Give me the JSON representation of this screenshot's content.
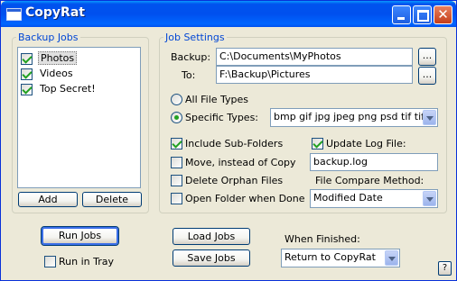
{
  "window": {
    "title": "CopyRat",
    "icons": {
      "app": "app-window-icon",
      "minimize": "minimize-icon",
      "maximize": "maximize-icon",
      "close": "close-icon"
    },
    "close_glyph": "✕"
  },
  "backup_jobs": {
    "legend": "Backup Jobs",
    "items": [
      {
        "label": "Photos",
        "checked": true,
        "selected": true
      },
      {
        "label": "Videos",
        "checked": true,
        "selected": false
      },
      {
        "label": "Top Secret!",
        "checked": true,
        "selected": false
      }
    ],
    "add_label": "Add",
    "delete_label": "Delete"
  },
  "job_settings": {
    "legend": "Job Settings",
    "backup_label": "Backup:",
    "backup_value": "C:\\Documents\\MyPhotos",
    "to_label": "To:",
    "to_value": "F:\\Backup\\Pictures",
    "browse_label": "...",
    "all_file_types_label": "All File Types",
    "specific_types_label": "Specific Types:",
    "specific_types_value": "bmp gif jpg jpeg png psd tif tiff tga",
    "file_type_mode": "specific",
    "include_subfolders_label": "Include Sub-Folders",
    "include_subfolders": true,
    "move_instead_label": "Move, instead of Copy",
    "move_instead": false,
    "delete_orphan_label": "Delete Orphan Files",
    "delete_orphan": false,
    "open_folder_label": "Open Folder when Done",
    "open_folder": false,
    "update_log_label": "Update Log File:",
    "update_log": true,
    "log_file_value": "backup.log",
    "compare_method_label": "File Compare Method:",
    "compare_method_value": "Modified Date"
  },
  "bottom": {
    "run_jobs_label": "Run Jobs",
    "run_in_tray_label": "Run in Tray",
    "run_in_tray": false,
    "load_jobs_label": "Load Jobs",
    "save_jobs_label": "Save Jobs",
    "when_finished_label": "When Finished:",
    "when_finished_value": "Return to CopyRat",
    "help_label": "?"
  }
}
